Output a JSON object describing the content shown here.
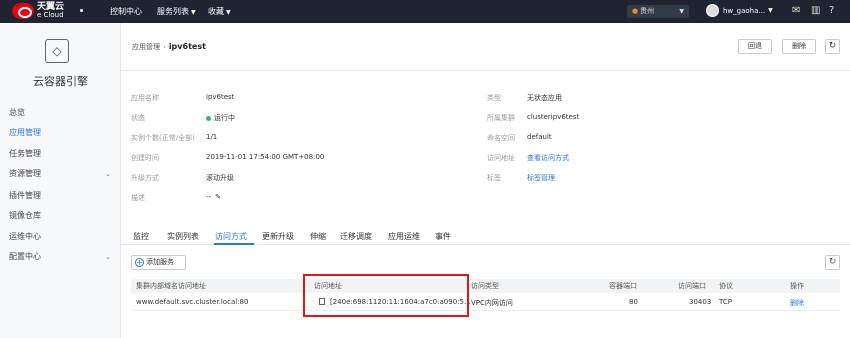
{
  "topbar": {
    "logo_cn": "天翼云",
    "logo_en": "e Cloud",
    "console": "控制中心",
    "services": "服务列表",
    "favorites": "收藏",
    "region": "贵州",
    "username": "hw_gaoha...",
    "mail_icon": "mail-icon",
    "stats_icon": "stats-icon",
    "help_icon": "help-icon"
  },
  "sidebar": {
    "title": "云容器引擎",
    "items": [
      {
        "label": "总览"
      },
      {
        "label": "应用管理"
      },
      {
        "label": "任务管理"
      },
      {
        "label": "资源管理"
      },
      {
        "label": "插件管理"
      },
      {
        "label": "镜像仓库"
      },
      {
        "label": "运维中心"
      },
      {
        "label": "配置中心"
      }
    ]
  },
  "header": {
    "crumb_parent": "应用管理",
    "crumb_current": "ipv6test",
    "rollback": "回退",
    "delete": "删除"
  },
  "info": {
    "left": [
      {
        "label": "应用名称",
        "value": "ipv6test"
      },
      {
        "label": "状态",
        "value": "运行中"
      },
      {
        "label": "实例个数(正常/全部)",
        "value": "1/1"
      },
      {
        "label": "创建时间",
        "value": "2019-11-01 17:54:00 GMT+08:00"
      },
      {
        "label": "升级方式",
        "value": "滚动升级"
      },
      {
        "label": "描述",
        "value": "--"
      }
    ],
    "right": [
      {
        "label": "类型",
        "value": "无状态应用"
      },
      {
        "label": "所属集群",
        "value": "clusteripv6test"
      },
      {
        "label": "命名空间",
        "value": "default"
      },
      {
        "label": "访问地址",
        "value": "查看访问方式"
      },
      {
        "label": "标签",
        "value": "标签管理"
      }
    ]
  },
  "tabs": [
    {
      "label": "监控"
    },
    {
      "label": "实例列表"
    },
    {
      "label": "访问方式"
    },
    {
      "label": "更新升级"
    },
    {
      "label": "伸缩"
    },
    {
      "label": "迁移调度"
    },
    {
      "label": "应用运维"
    },
    {
      "label": "事件"
    }
  ],
  "service": {
    "add_label": "添加服务",
    "columns": {
      "domain": "集群内部域名访问地址",
      "address": "访问地址",
      "type": "访问类型",
      "container_port": "容器端口",
      "access_port": "访问端口",
      "protocol": "协议",
      "action": "操作"
    },
    "rows": [
      {
        "domain": "www.default.svc.cluster.local:80",
        "address": "[240e:698:1120:11:1604:a7c0:a090:5...",
        "type": "VPC内网访问",
        "container_port": "80",
        "access_port": "30403",
        "protocol": "TCP",
        "action": "删除"
      }
    ]
  },
  "colors": {
    "accent": "#2b77d9",
    "highlight": "#e01818",
    "running": "#3cb371",
    "topbar": "#1f2430"
  }
}
